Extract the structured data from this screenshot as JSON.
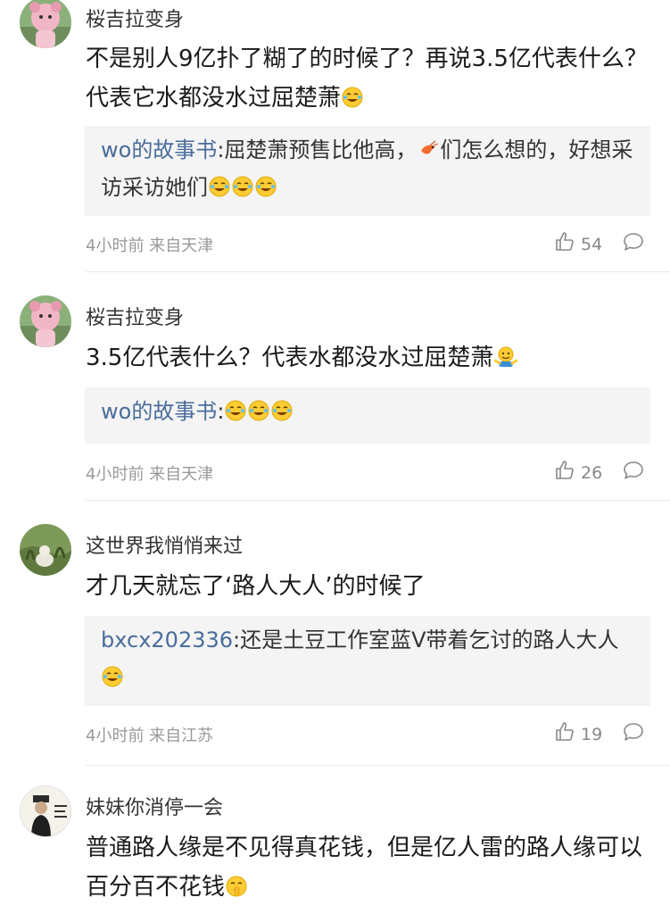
{
  "comments": [
    {
      "username": "桜吉拉变身",
      "text": "不是别人9亿扑了糊了的时候了？再说3.5亿代表什么？代表它水都没水过屈楚萧",
      "quote_user": "wo的故事书",
      "quote_text": ":屈楚萧预售比他高，",
      "quote_text2": "们怎么想的，好想采访采访她们",
      "meta": "4小时前 来自天津",
      "likes": "54"
    },
    {
      "username": "桜吉拉变身",
      "text": "3.5亿代表什么？代表水都没水过屈楚萧",
      "quote_user": "wo的故事书",
      "quote_text": ":",
      "meta": "4小时前 来自天津",
      "likes": "26"
    },
    {
      "username": "这世界我悄悄来过",
      "text": "才几天就忘了‘路人大人’的时候了",
      "quote_user": "bxcx202336",
      "quote_text": ":还是土豆工作室蓝V带着乞讨的路人大人",
      "meta": "4小时前 来自江苏",
      "likes": "19"
    },
    {
      "username": "妹妹你消停一会",
      "text": "普通路人缘是不见得真花钱，但是亿人雷的路人缘可以百分百不花钱"
    }
  ],
  "colors": {
    "link": "#496c9b",
    "quote_bg": "#f4f4f4",
    "meta": "#999999"
  },
  "icons": [
    "avatar",
    "laugh-cry-emoji",
    "shrimp-emoji",
    "shrug-emoji",
    "shush-emoji",
    "thumbs-up-icon",
    "reply-bubble-icon"
  ]
}
